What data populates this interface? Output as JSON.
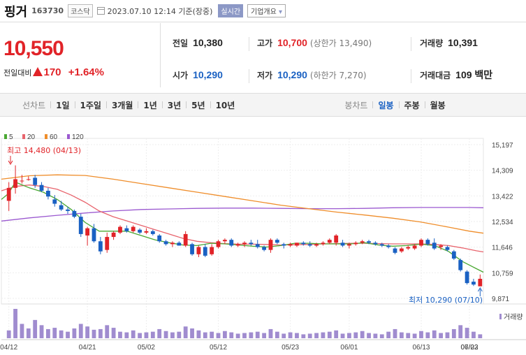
{
  "header": {
    "name": "핑거",
    "code": "163730",
    "market": "코스닥",
    "date": "2023.07.10 12:14 기준(장중)",
    "realtime": "실시간",
    "company": "기업개요"
  },
  "price": {
    "current": "10,550",
    "change_label": "전일대비",
    "change": "170",
    "change_pct": "+1.64%"
  },
  "stats": {
    "prev_label": "전일",
    "prev": "10,380",
    "high_label": "고가",
    "high": "10,700",
    "upper_limit": "(상한가 13,490)",
    "volume_label": "거래량",
    "volume": "10,391",
    "open_label": "시가",
    "open": "10,290",
    "low_label": "저가",
    "low": "10,290",
    "lower_limit": "(하한가 7,270)",
    "amount_label": "거래대금",
    "amount": "109 백만"
  },
  "tabs": {
    "line_chart": "선차트",
    "d1": "1일",
    "w1": "1주일",
    "m3": "3개월",
    "y1": "1년",
    "y3": "3년",
    "y5": "5년",
    "y10": "10년",
    "candle": "봉차트",
    "daily": "일봉",
    "weekly": "주봉",
    "monthly": "월봉"
  },
  "colors": {
    "up": "#e12328",
    "down": "#1a61c3",
    "ma5": "#4aa832",
    "ma20": "#e8646d",
    "ma60": "#ef8d2a",
    "ma120": "#9b59d0",
    "volume": "#a08ccf"
  },
  "chart_data": {
    "type": "candlestick",
    "legend": [
      {
        "name": "5",
        "color": "#4aa832"
      },
      {
        "name": "20",
        "color": "#e8646d"
      },
      {
        "name": "60",
        "color": "#ef8d2a"
      },
      {
        "name": "120",
        "color": "#9b59d0"
      }
    ],
    "y_ticks": [
      "15,197",
      "14,309",
      "13,422",
      "12,534",
      "11,646",
      "10,759",
      "9,871"
    ],
    "x_ticks": [
      "04/12",
      "04/21",
      "05/02",
      "05/12",
      "05/23",
      "06/01",
      "06/13",
      "06/22",
      "07/03"
    ],
    "high_annotation": "최고 14,480 (04/13)",
    "low_annotation": "최저 10,290 (07/10)",
    "volume_label": "거래량",
    "candles": [
      {
        "o": 13250,
        "h": 13900,
        "l": 12900,
        "c": 13700
      },
      {
        "o": 13700,
        "h": 14480,
        "l": 13500,
        "c": 14000
      },
      {
        "o": 13950,
        "h": 14150,
        "l": 13850,
        "c": 13950
      },
      {
        "o": 14000,
        "h": 14100,
        "l": 13950,
        "c": 14000
      },
      {
        "o": 14050,
        "h": 14150,
        "l": 13700,
        "c": 13800
      },
      {
        "o": 13800,
        "h": 13900,
        "l": 13550,
        "c": 13600
      },
      {
        "o": 13600,
        "h": 13700,
        "l": 13300,
        "c": 13400
      },
      {
        "o": 13300,
        "h": 13450,
        "l": 13050,
        "c": 13150
      },
      {
        "o": 13100,
        "h": 13250,
        "l": 12900,
        "c": 12950
      },
      {
        "o": 12950,
        "h": 13050,
        "l": 12800,
        "c": 12900
      },
      {
        "o": 12900,
        "h": 12950,
        "l": 12650,
        "c": 12700
      },
      {
        "o": 12700,
        "h": 12800,
        "l": 12000,
        "c": 12100
      },
      {
        "o": 12050,
        "h": 12350,
        "l": 11700,
        "c": 12300
      },
      {
        "o": 12300,
        "h": 12450,
        "l": 11800,
        "c": 11850
      },
      {
        "o": 11850,
        "h": 12000,
        "l": 11400,
        "c": 11500
      },
      {
        "o": 11550,
        "h": 12150,
        "l": 11450,
        "c": 12000
      },
      {
        "o": 12000,
        "h": 12200,
        "l": 11900,
        "c": 12150
      },
      {
        "o": 12150,
        "h": 12400,
        "l": 12100,
        "c": 12350
      },
      {
        "o": 12300,
        "h": 12400,
        "l": 12150,
        "c": 12200
      },
      {
        "o": 12200,
        "h": 12400,
        "l": 12150,
        "c": 12350
      },
      {
        "o": 12250,
        "h": 12300,
        "l": 12100,
        "c": 12150
      },
      {
        "o": 12150,
        "h": 12300,
        "l": 12100,
        "c": 12200
      },
      {
        "o": 12200,
        "h": 12250,
        "l": 12050,
        "c": 12100
      },
      {
        "o": 12050,
        "h": 12100,
        "l": 11800,
        "c": 11850
      },
      {
        "o": 11850,
        "h": 11900,
        "l": 11700,
        "c": 11750
      },
      {
        "o": 11750,
        "h": 11850,
        "l": 11650,
        "c": 11800
      },
      {
        "o": 11800,
        "h": 11850,
        "l": 11700,
        "c": 11700
      },
      {
        "o": 11700,
        "h": 12200,
        "l": 11650,
        "c": 12100
      },
      {
        "o": 11750,
        "h": 11800,
        "l": 11350,
        "c": 11400
      },
      {
        "o": 11400,
        "h": 11700,
        "l": 11300,
        "c": 11650
      },
      {
        "o": 11650,
        "h": 11750,
        "l": 11300,
        "c": 11350
      },
      {
        "o": 11400,
        "h": 11750,
        "l": 11350,
        "c": 11650
      },
      {
        "o": 11650,
        "h": 11900,
        "l": 11600,
        "c": 11850
      },
      {
        "o": 11850,
        "h": 11950,
        "l": 11750,
        "c": 11900
      },
      {
        "o": 11900,
        "h": 11950,
        "l": 11650,
        "c": 11700
      },
      {
        "o": 11700,
        "h": 11800,
        "l": 11650,
        "c": 11750
      },
      {
        "o": 11750,
        "h": 11850,
        "l": 11650,
        "c": 11800
      },
      {
        "o": 11800,
        "h": 11900,
        "l": 11700,
        "c": 11750
      },
      {
        "o": 11750,
        "h": 11900,
        "l": 11600,
        "c": 11650
      },
      {
        "o": 11650,
        "h": 11700,
        "l": 11500,
        "c": 11550
      },
      {
        "o": 11550,
        "h": 11950,
        "l": 11450,
        "c": 11900
      },
      {
        "o": 11900,
        "h": 11950,
        "l": 11750,
        "c": 11800
      },
      {
        "o": 11750,
        "h": 11800,
        "l": 11600,
        "c": 11700
      },
      {
        "o": 11700,
        "h": 11800,
        "l": 11650,
        "c": 11750
      },
      {
        "o": 11700,
        "h": 11800,
        "l": 11650,
        "c": 11800
      },
      {
        "o": 11800,
        "h": 11850,
        "l": 11700,
        "c": 11750
      },
      {
        "o": 11750,
        "h": 11850,
        "l": 11650,
        "c": 11700
      },
      {
        "o": 11700,
        "h": 11800,
        "l": 11650,
        "c": 11750
      },
      {
        "o": 11750,
        "h": 11850,
        "l": 11700,
        "c": 11800
      },
      {
        "o": 11800,
        "h": 11950,
        "l": 11750,
        "c": 11900
      },
      {
        "o": 11800,
        "h": 12100,
        "l": 11700,
        "c": 12050
      },
      {
        "o": 11800,
        "h": 11900,
        "l": 11650,
        "c": 11700
      },
      {
        "o": 11700,
        "h": 11800,
        "l": 11600,
        "c": 11750
      },
      {
        "o": 11750,
        "h": 11850,
        "l": 11700,
        "c": 11800
      },
      {
        "o": 11800,
        "h": 11900,
        "l": 11750,
        "c": 11850
      },
      {
        "o": 11850,
        "h": 11900,
        "l": 11750,
        "c": 11800
      },
      {
        "o": 11800,
        "h": 11850,
        "l": 11700,
        "c": 11750
      },
      {
        "o": 11750,
        "h": 11800,
        "l": 11650,
        "c": 11700
      },
      {
        "o": 11700,
        "h": 11750,
        "l": 11600,
        "c": 11650
      },
      {
        "o": 11600,
        "h": 11650,
        "l": 11400,
        "c": 11450
      },
      {
        "o": 11500,
        "h": 11650,
        "l": 11450,
        "c": 11600
      },
      {
        "o": 11600,
        "h": 11700,
        "l": 11550,
        "c": 11650
      },
      {
        "o": 11600,
        "h": 11750,
        "l": 11550,
        "c": 11700
      },
      {
        "o": 11700,
        "h": 11950,
        "l": 11650,
        "c": 11900
      },
      {
        "o": 11900,
        "h": 11950,
        "l": 11700,
        "c": 11750
      },
      {
        "o": 11800,
        "h": 11950,
        "l": 11550,
        "c": 11600
      },
      {
        "o": 11650,
        "h": 11750,
        "l": 11550,
        "c": 11700
      },
      {
        "o": 11650,
        "h": 11700,
        "l": 11500,
        "c": 11550
      },
      {
        "o": 11500,
        "h": 11550,
        "l": 11200,
        "c": 11250
      },
      {
        "o": 11200,
        "h": 11250,
        "l": 10800,
        "c": 10850
      },
      {
        "o": 10800,
        "h": 10850,
        "l": 10350,
        "c": 10400
      },
      {
        "o": 10450,
        "h": 10550,
        "l": 10300,
        "c": 10350
      },
      {
        "o": 10290,
        "h": 10700,
        "l": 10290,
        "c": 10550
      }
    ],
    "volume": [
      12,
      45,
      22,
      15,
      28,
      20,
      14,
      16,
      12,
      10,
      15,
      22,
      18,
      13,
      14,
      20,
      16,
      10,
      9,
      12,
      8,
      9,
      10,
      14,
      11,
      9,
      10,
      18,
      15,
      12,
      9,
      10,
      8,
      11,
      9,
      7,
      8,
      9,
      10,
      8,
      14,
      10,
      7,
      9,
      8,
      6,
      7,
      8,
      9,
      10,
      12,
      7,
      8,
      9,
      11,
      8,
      7,
      6,
      10,
      14,
      9,
      8,
      7,
      11,
      9,
      12,
      8,
      9,
      14,
      20,
      16,
      10,
      6
    ],
    "ma_points": {
      "ma5": [
        [
          0,
          13300
        ],
        [
          10,
          13500
        ],
        [
          20,
          13900
        ],
        [
          40,
          13700
        ],
        [
          60,
          13550
        ],
        [
          80,
          13300
        ],
        [
          100,
          12950
        ],
        [
          120,
          12500
        ],
        [
          140,
          12200
        ],
        [
          160,
          12200
        ],
        [
          180,
          12200
        ],
        [
          200,
          12050
        ],
        [
          220,
          11900
        ],
        [
          240,
          11800
        ],
        [
          260,
          11720
        ],
        [
          280,
          11700
        ],
        [
          300,
          11780
        ],
        [
          320,
          11760
        ],
        [
          340,
          11720
        ],
        [
          360,
          11680
        ],
        [
          380,
          11650
        ],
        [
          400,
          11700
        ],
        [
          420,
          11780
        ],
        [
          440,
          11780
        ],
        [
          460,
          11760
        ],
        [
          480,
          11760
        ],
        [
          500,
          11760
        ],
        [
          520,
          11800
        ],
        [
          540,
          11720
        ],
        [
          560,
          11680
        ],
        [
          580,
          11700
        ],
        [
          600,
          11750
        ],
        [
          620,
          11700
        ],
        [
          640,
          11500
        ],
        [
          660,
          11150
        ],
        [
          680,
          10900
        ],
        [
          690,
          10780
        ]
      ],
      "ma20": [
        [
          0,
          13600
        ],
        [
          20,
          13750
        ],
        [
          40,
          13800
        ],
        [
          60,
          13750
        ],
        [
          80,
          13650
        ],
        [
          100,
          13450
        ],
        [
          120,
          13200
        ],
        [
          140,
          12900
        ],
        [
          160,
          12700
        ],
        [
          180,
          12550
        ],
        [
          200,
          12400
        ],
        [
          220,
          12250
        ],
        [
          240,
          12100
        ],
        [
          260,
          11950
        ],
        [
          280,
          11850
        ],
        [
          300,
          11800
        ],
        [
          320,
          11770
        ],
        [
          340,
          11750
        ],
        [
          360,
          11750
        ],
        [
          380,
          11740
        ],
        [
          400,
          11720
        ],
        [
          420,
          11730
        ],
        [
          440,
          11740
        ],
        [
          460,
          11760
        ],
        [
          480,
          11770
        ],
        [
          500,
          11780
        ],
        [
          520,
          11780
        ],
        [
          540,
          11770
        ],
        [
          560,
          11760
        ],
        [
          580,
          11760
        ],
        [
          600,
          11760
        ],
        [
          620,
          11740
        ],
        [
          640,
          11700
        ],
        [
          660,
          11620
        ],
        [
          680,
          11520
        ],
        [
          690,
          11480
        ]
      ],
      "ma60": [
        [
          0,
          14000
        ],
        [
          40,
          14120
        ],
        [
          80,
          14150
        ],
        [
          120,
          14130
        ],
        [
          160,
          14000
        ],
        [
          200,
          13850
        ],
        [
          240,
          13700
        ],
        [
          280,
          13550
        ],
        [
          320,
          13400
        ],
        [
          360,
          13250
        ],
        [
          400,
          13100
        ],
        [
          440,
          12980
        ],
        [
          480,
          12860
        ],
        [
          520,
          12760
        ],
        [
          560,
          12650
        ],
        [
          600,
          12520
        ],
        [
          640,
          12340
        ],
        [
          670,
          12200
        ],
        [
          690,
          12130
        ]
      ],
      "ma120": [
        [
          0,
          12550
        ],
        [
          40,
          12660
        ],
        [
          80,
          12750
        ],
        [
          120,
          12830
        ],
        [
          160,
          12900
        ],
        [
          200,
          12950
        ],
        [
          240,
          12970
        ],
        [
          280,
          12990
        ],
        [
          320,
          13000
        ],
        [
          360,
          13000
        ],
        [
          400,
          12990
        ],
        [
          440,
          12980
        ],
        [
          480,
          12980
        ],
        [
          520,
          12990
        ],
        [
          560,
          13010
        ],
        [
          600,
          13020
        ],
        [
          640,
          13020
        ],
        [
          670,
          13020
        ],
        [
          690,
          13010
        ]
      ]
    }
  }
}
